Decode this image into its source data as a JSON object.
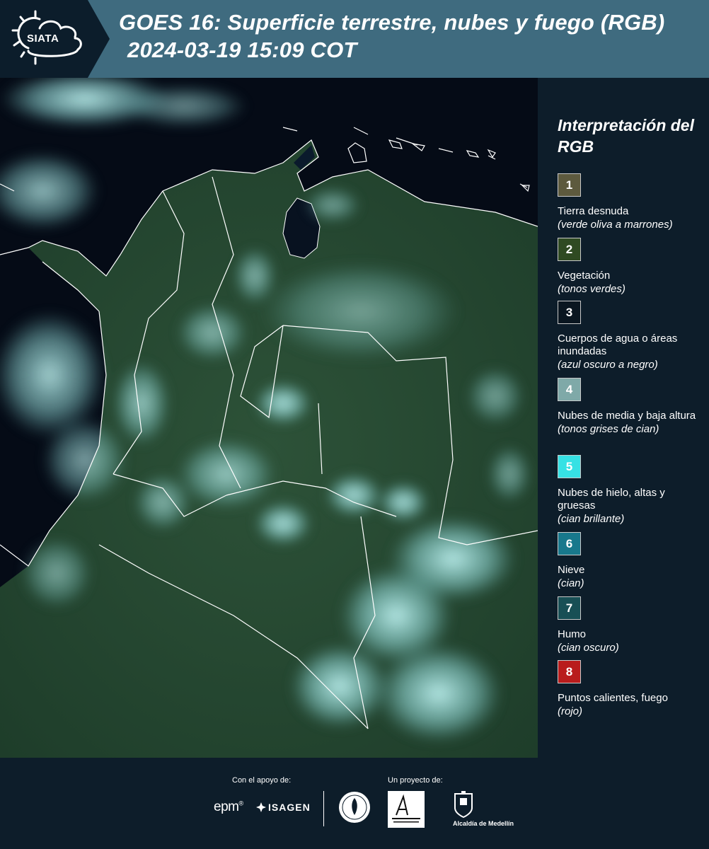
{
  "header": {
    "logo_text": "SIATA",
    "title_line1": "GOES 16: Superficie terrestre, nubes y fuego (RGB)",
    "title_line2": "2024-03-19 15:09 COT"
  },
  "legend": {
    "title": "Interpretación del RGB",
    "items": [
      {
        "number": "1",
        "label": "Tierra desnuda",
        "note": "(verde oliva a marrones)",
        "color": "#5d5a3e"
      },
      {
        "number": "2",
        "label": "Vegetación",
        "note": "(tonos verdes)",
        "color": "#2f4a22"
      },
      {
        "number": "3",
        "label": "Cuerpos de agua o áreas inundadas",
        "note": "(azul oscuro a negro)",
        "color": "#0a1620"
      },
      {
        "number": "4",
        "label": "Nubes de media y baja altura",
        "note": "(tonos grises de cian)",
        "color": "#7fa9a8"
      },
      {
        "number": "5",
        "label": "Nubes de hielo, altas y gruesas",
        "note": "(cian brillante)",
        "color": "#36e1e4"
      },
      {
        "number": "6",
        "label": "Nieve",
        "note": "(cian)",
        "color": "#18788c"
      },
      {
        "number": "7",
        "label": "Humo",
        "note": "(cian oscuro)",
        "color": "#184f55"
      },
      {
        "number": "8",
        "label": "Puntos calientes, fuego",
        "note": "(rojo)",
        "color": "#b91c1c"
      }
    ]
  },
  "footer": {
    "support_label": "Con el apoyo de:",
    "project_label": "Un proyecto de:",
    "epm": "epm",
    "isagen": "ISAGEN",
    "alcaldia": "Alcaldía de Medellín"
  },
  "map": {
    "background_color": "#050b16",
    "land_color": "#264a33",
    "cloud_color": "#9fe7e6",
    "border_color": "#ffffff"
  }
}
